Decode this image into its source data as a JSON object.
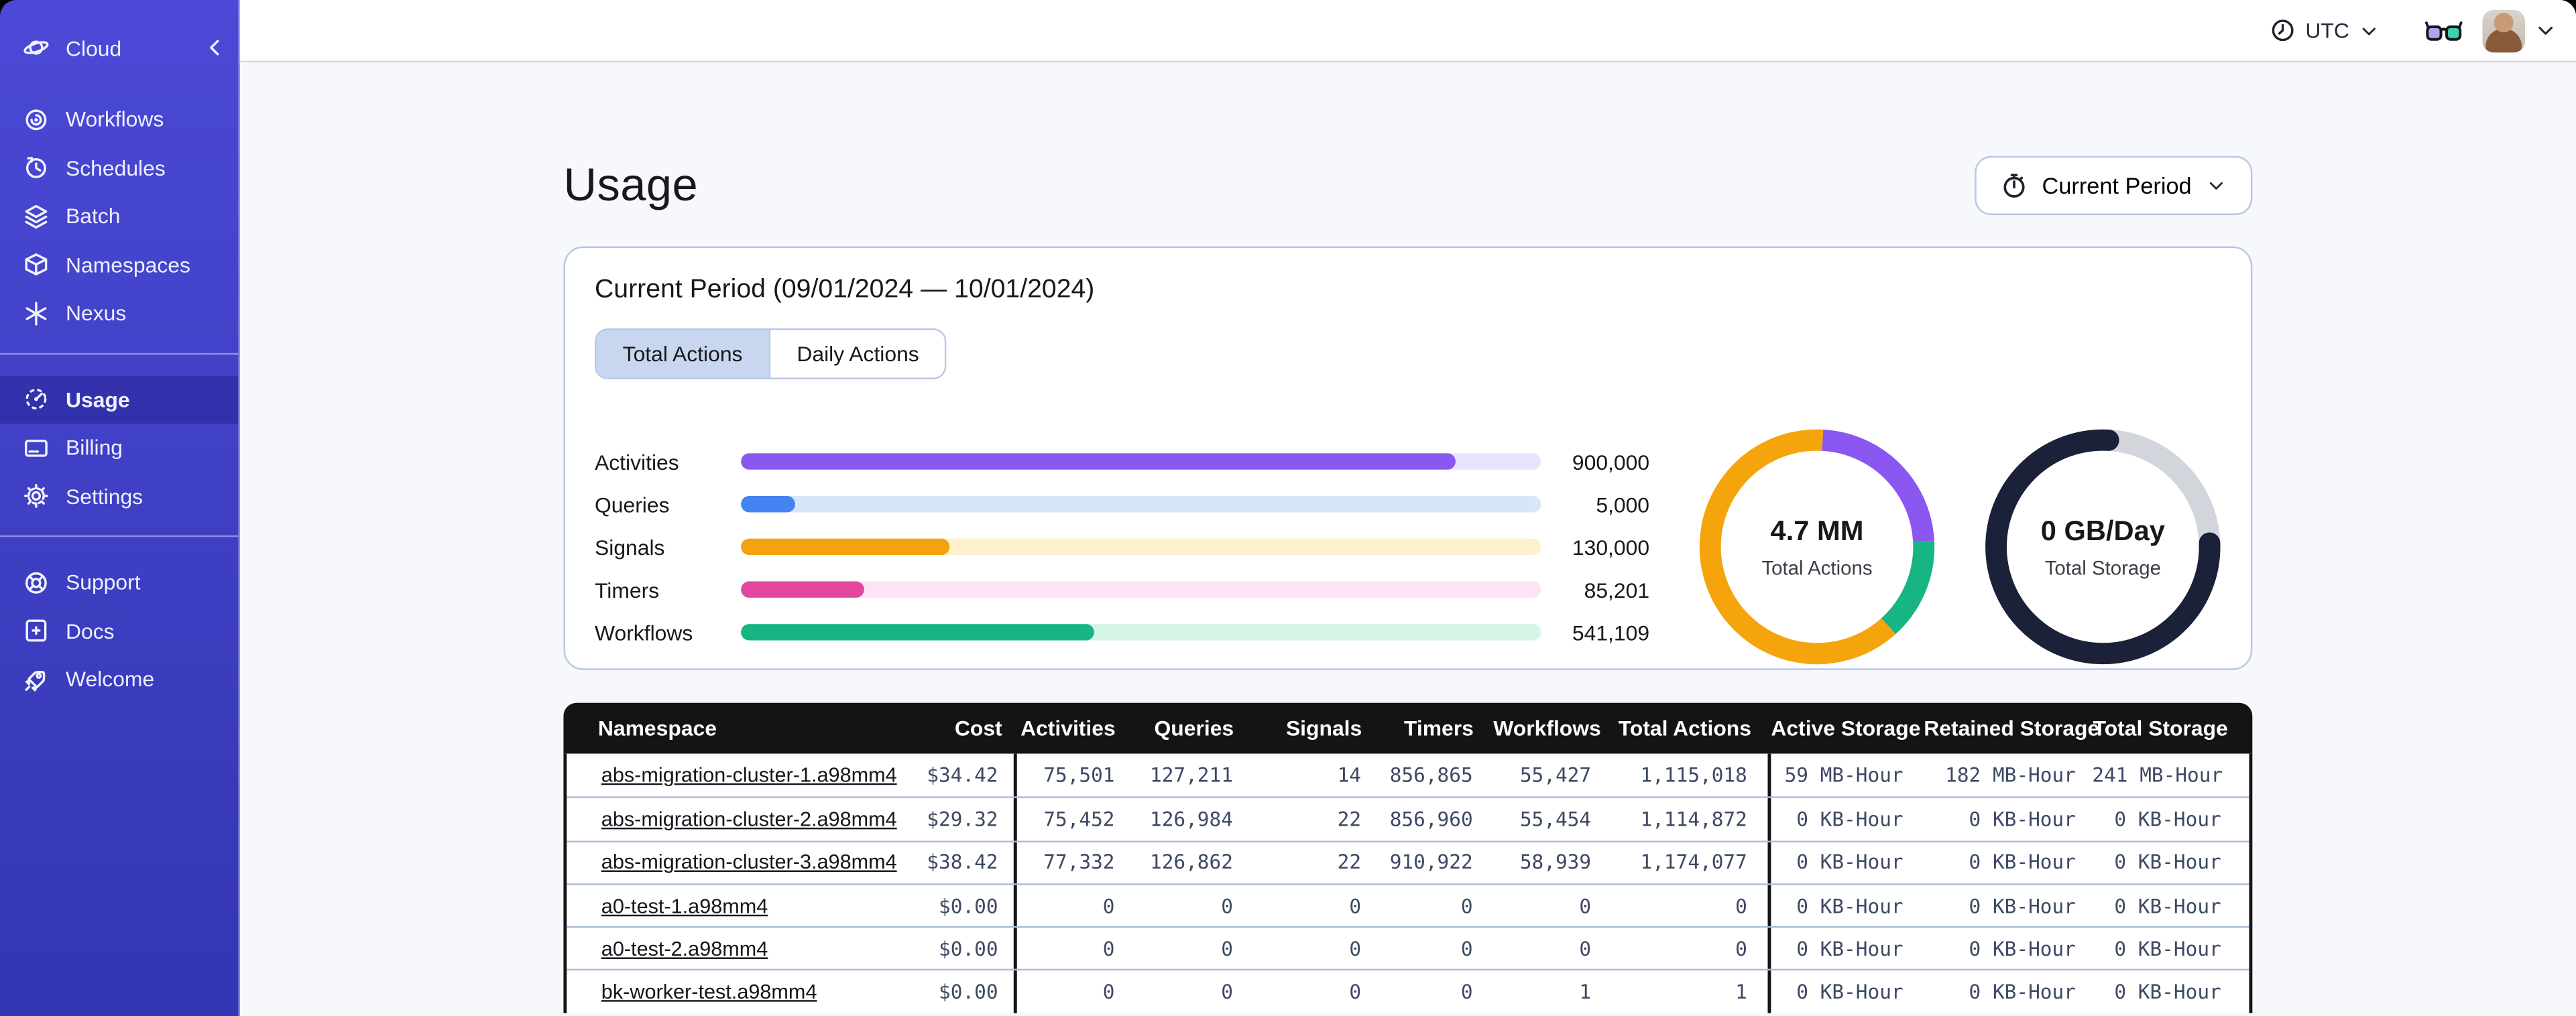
{
  "theme": {
    "sidebar_top": "#4b49d6",
    "sidebar_bottom": "#3336b2",
    "content_bg": "#f7f8fb",
    "card_border": "#b9c6e6",
    "tab_active_bg": "#c9d6f0",
    "table_header_bg": "#141414",
    "row_divider": "#a9bcdb",
    "num_color": "#3d4963"
  },
  "topbar": {
    "timezone": "UTC"
  },
  "sidebar": {
    "header": {
      "label": "Cloud"
    },
    "items": [
      {
        "label": "Workflows"
      },
      {
        "label": "Schedules"
      },
      {
        "label": "Batch"
      },
      {
        "label": "Namespaces"
      },
      {
        "label": "Nexus"
      },
      {
        "label": "Usage",
        "active": true
      },
      {
        "label": "Billing"
      },
      {
        "label": "Settings"
      },
      {
        "label": "Support"
      },
      {
        "label": "Docs"
      },
      {
        "label": "Welcome"
      }
    ]
  },
  "page": {
    "title": "Usage",
    "period_button": "Current Period"
  },
  "card": {
    "title": "Current Period (09/01/2024 — 10/01/2024)",
    "tabs": [
      "Total Actions",
      "Daily Actions"
    ],
    "active_tab": "Total Actions"
  },
  "chart_data": [
    {
      "type": "bar",
      "orientation": "horizontal",
      "title": "Actions by type",
      "categories": [
        "Activities",
        "Queries",
        "Signals",
        "Timers",
        "Workflows"
      ],
      "values": [
        900000,
        5000,
        130000,
        85201,
        541109
      ],
      "display_values": [
        "900,000",
        "5,000",
        "130,000",
        "85,201",
        "541,109"
      ],
      "fill_fractions": [
        0.894,
        0.067,
        0.261,
        0.155,
        0.441
      ],
      "bar_colors": [
        "#8a57f0",
        "#4484f0",
        "#f2a30d",
        "#e2479d",
        "#16b583"
      ],
      "track_colors": [
        "#eae3fc",
        "#d8e6fa",
        "#fdf2cd",
        "#fbe4f5",
        "#d5f6e6"
      ],
      "grid": false,
      "legend": "none"
    },
    {
      "type": "donut",
      "center_value": "4.7 MM",
      "center_label": "Total Actions",
      "segments": [
        {
          "name": "activities",
          "color": "#8a57f0",
          "start_deg": 3,
          "end_deg": 87,
          "linecap": "butt"
        },
        {
          "name": "workflows",
          "color": "#16b583",
          "start_deg": 87,
          "end_deg": 138,
          "linecap": "butt"
        },
        {
          "name": "other",
          "color": "#f5a40b",
          "start_deg": 138,
          "end_deg": 363,
          "linecap": "butt"
        }
      ]
    },
    {
      "type": "donut",
      "center_value": "0 GB/Day",
      "center_label": "Total Storage",
      "segments": [
        {
          "name": "used",
          "color": "#d2d5db",
          "start_deg": 3,
          "end_deg": 88,
          "linecap": "butt"
        },
        {
          "name": "remaining",
          "color": "#1a2138",
          "start_deg": 88,
          "end_deg": 363,
          "linecap": "round"
        }
      ]
    }
  ],
  "table": {
    "headers": [
      "Namespace",
      "Cost",
      "Activities",
      "Queries",
      "Signals",
      "Timers",
      "Workflows",
      "Total Actions",
      "Active Storage",
      "Retained Storage",
      "Total Storage"
    ],
    "rows": [
      [
        "abs-migration-cluster-1.a98mm4",
        "$34.42",
        "75,501",
        "127,211",
        "14",
        "856,865",
        "55,427",
        "1,115,018",
        "59 MB-Hour",
        "182 MB-Hour",
        "241 MB-Hour"
      ],
      [
        "abs-migration-cluster-2.a98mm4",
        "$29.32",
        "75,452",
        "126,984",
        "22",
        "856,960",
        "55,454",
        "1,114,872",
        "0 KB-Hour",
        "0 KB-Hour",
        "0 KB-Hour"
      ],
      [
        "abs-migration-cluster-3.a98mm4",
        "$38.42",
        "77,332",
        "126,862",
        "22",
        "910,922",
        "58,939",
        "1,174,077",
        "0 KB-Hour",
        "0 KB-Hour",
        "0 KB-Hour"
      ],
      [
        "a0-test-1.a98mm4",
        "$0.00",
        "0",
        "0",
        "0",
        "0",
        "0",
        "0",
        "0 KB-Hour",
        "0 KB-Hour",
        "0 KB-Hour"
      ],
      [
        "a0-test-2.a98mm4",
        "$0.00",
        "0",
        "0",
        "0",
        "0",
        "0",
        "0",
        "0 KB-Hour",
        "0 KB-Hour",
        "0 KB-Hour"
      ],
      [
        "bk-worker-test.a98mm4",
        "$0.00",
        "0",
        "0",
        "0",
        "0",
        "1",
        "1",
        "0 KB-Hour",
        "0 KB-Hour",
        "0 KB-Hour"
      ]
    ]
  }
}
